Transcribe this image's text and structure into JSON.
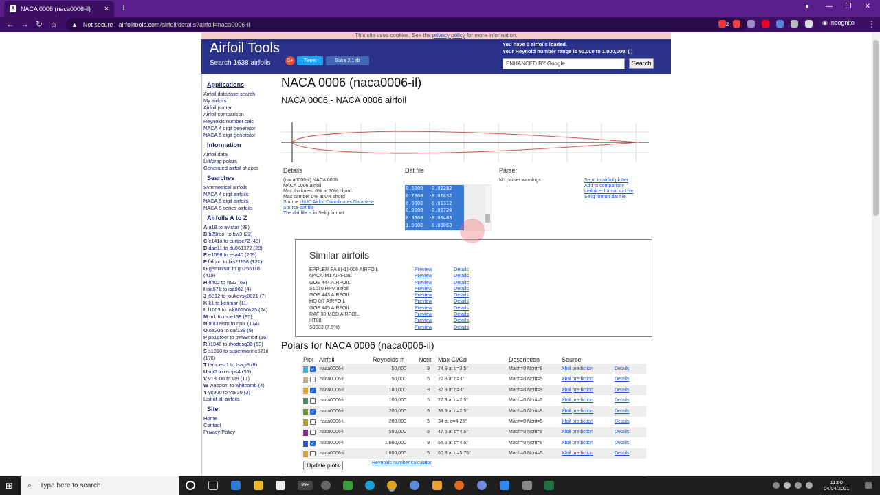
{
  "browser": {
    "tab_title": "NACA 0006 (naca0006-il)",
    "tab_icon": "A",
    "new_tab": "+",
    "close_tab": "×",
    "security": "Not secure",
    "url_host": "airfoiltools.com",
    "url_path": "/airfoil/details?airfoil=naca0006-il",
    "profile": "Incognito"
  },
  "cookie": {
    "prefix": "This site uses cookies. See the ",
    "link": "privacy policy",
    "suffix": " for more information."
  },
  "header": {
    "title": "Airfoil Tools",
    "subtitle": "Search 1638 airfoils",
    "tweet": "Tweet",
    "like": "Suka 2,1 rb",
    "loaded": "You have 0 airfoils loaded.",
    "reynolds": "Your Reynold number range is 50,000 to 1,000,000. ( )",
    "search_placeholder": "ENHANCED BY Google",
    "search_button": "Search"
  },
  "sidebar": {
    "applications_heading": "Applications",
    "applications": [
      "Airfoil database search",
      "My airfoils",
      "Airfoil plotter",
      "Airfoil comparison",
      "Reynolds number calc",
      "NACA 4 digit generator",
      "NACA 5 digit generator"
    ],
    "information_heading": "Information",
    "information": [
      "Airfoil data",
      "Lift/drag polars",
      "Generated airfoil shapes"
    ],
    "searches_heading": "Searches",
    "searches": [
      "Symmetrical airfoils",
      "NACA 4 digit airfoils",
      "NACA 5 digit airfoils",
      "NACA 6 series airfoils"
    ],
    "atoz_heading": "Airfoils A to Z",
    "atoz": [
      {
        "l": "A",
        "t": " a18 to avistar (88)"
      },
      {
        "l": "B",
        "t": " b29root to bw3 (22)"
      },
      {
        "l": "C",
        "t": " c141a to curtisc72 (40)"
      },
      {
        "l": "D",
        "t": " dae11 to du861372 (28)"
      },
      {
        "l": "E",
        "t": " e1098 to esa40 (209)"
      },
      {
        "l": "F",
        "t": " falcon to fxs21158 (121)"
      },
      {
        "l": "G",
        "t": " geminism to gu255118"
      },
      {
        "l": "",
        "t": "(419)"
      },
      {
        "l": "H",
        "t": " hh02 to ht23 (63)"
      },
      {
        "l": "I",
        "t": " isa571 to isa962 (4)"
      },
      {
        "l": "J",
        "t": " j5012 to joukovsk0021 (7)"
      },
      {
        "l": "K",
        "t": " k1 to kenmar (11)"
      },
      {
        "l": "L",
        "t": " l1003 to lwk80150k25 (24)"
      },
      {
        "l": "M",
        "t": " m1 to mue139 (95)"
      },
      {
        "l": "N",
        "t": " n0009sm to nplx (174)"
      },
      {
        "l": "O",
        "t": " oa206 to oaf139 (9)"
      },
      {
        "l": "P",
        "t": " p51droot to pw98mod (16)"
      },
      {
        "l": "R",
        "t": " r1046 to rhodesg36 (63)"
      },
      {
        "l": "S",
        "t": " s1010 to supermarine371ii"
      },
      {
        "l": "",
        "t": "(176)"
      },
      {
        "l": "T",
        "t": " tempest1 to tsagi8 (8)"
      },
      {
        "l": "U",
        "t": " ua2 to usnps4 (36)"
      },
      {
        "l": "V",
        "t": " v13006 to vr9 (17)"
      },
      {
        "l": "W",
        "t": " waspsm to whitcomb (4)"
      },
      {
        "l": "Y",
        "t": " ys900 to ys930 (3)"
      },
      {
        "l": "",
        "t": "List of all airfoils"
      }
    ],
    "site_heading": "Site",
    "site": [
      "Home",
      "Contact",
      "Privacy Policy"
    ]
  },
  "main": {
    "title": "NACA 0006 (naca0006-il)",
    "subtitle": "NACA 0006 - NACA 0006 airfoil",
    "details_heading": "Details",
    "details_lines": [
      "(naca0006-il) NACA 0006",
      "NACA 0006 airfoil",
      "Max thickness 6% at 30% chord.",
      "Max camber 0% at 0% chord"
    ],
    "source_prefix": "Source ",
    "source_link": "UIUC Airfoil Coordinates Database",
    "source_dat": "Source dat file",
    "selig_note": "The dat file is in Selig format",
    "dat_heading": "Dat file",
    "dat_lines": [
      "0.6000  -0.02282",
      "0.7000  -0.01832",
      "0.8000  -0.01312",
      "0.9000  -0.00724",
      "0.9500  -0.00403",
      "1.0000  -0.00063"
    ],
    "parser_heading": "Parser",
    "parser_text": "No parser warnings",
    "links": [
      "Send to airfoil plotter",
      "Add to comparison",
      "Lednicer format dat file",
      "Selig format dat file"
    ]
  },
  "similar": {
    "title": "Similar airfoils",
    "preview": "Preview",
    "details": "Details",
    "items": [
      "EPPLER EA 8(-1)-006 AIRFOIL",
      "NACA-M1 AIRFOIL",
      "GOE 444 AIRFOIL",
      "S1010 HPV airfoil",
      "GOE 443 AIRFOIL",
      "HQ 0/7 AIRFOIL",
      "GOE 445 AIRFOIL",
      "RAF 30 MOD AIRFOIL",
      "HT08",
      "S9033 (7.5%)"
    ]
  },
  "polars": {
    "title": "Polars for NACA 0006 (naca0006-il)",
    "headers": [
      "Plot",
      "Airfoil",
      "Reynolds #",
      "Ncrit",
      "Max Cl/Cd",
      "Description",
      "Source"
    ],
    "rows": [
      {
        "color": "#3fb4d8",
        "checked": true,
        "airfoil": "naca0006-il",
        "re": "50,000",
        "ncrit": "9",
        "max": "24.9 at α=3.5°",
        "desc": "Mach=0 Ncrit=9",
        "src": "Xfoil prediction",
        "det": "Details"
      },
      {
        "color": "#c2b388",
        "checked": false,
        "airfoil": "naca0006-il",
        "re": "50,000",
        "ncrit": "5",
        "max": "22.8 at α=3°",
        "desc": "Mach=0 Ncrit=5",
        "src": "Xfoil prediction",
        "det": "Details"
      },
      {
        "color": "#e8a52e",
        "checked": true,
        "airfoil": "naca0006-il",
        "re": "100,000",
        "ncrit": "9",
        "max": "32.9 at α=3°",
        "desc": "Mach=0 Ncrit=9",
        "src": "Xfoil prediction",
        "det": "Details"
      },
      {
        "color": "#4a8f6a",
        "checked": false,
        "airfoil": "naca0006-il",
        "re": "100,000",
        "ncrit": "5",
        "max": "27.3 at α=2.5°",
        "desc": "Mach=0 Ncrit=5",
        "src": "Xfoil prediction",
        "det": "Details"
      },
      {
        "color": "#6e9b3a",
        "checked": true,
        "airfoil": "naca0006-il",
        "re": "200,000",
        "ncrit": "9",
        "max": "38.9 at α=2.5°",
        "desc": "Mach=0 Ncrit=9",
        "src": "Xfoil prediction",
        "det": "Details"
      },
      {
        "color": "#b59b2a",
        "checked": false,
        "airfoil": "naca0006-il",
        "re": "200,000",
        "ncrit": "5",
        "max": "34 at α=4.25°",
        "desc": "Mach=0 Ncrit=5",
        "src": "Xfoil prediction",
        "det": "Details"
      },
      {
        "color": "#8b2f8c",
        "checked": false,
        "airfoil": "naca0006-il",
        "re": "500,000",
        "ncrit": "5",
        "max": "47.6 at α=4.5°",
        "desc": "Mach=0 Ncrit=5",
        "src": "Xfoil prediction",
        "det": "Details"
      },
      {
        "color": "#2a5bd7",
        "checked": true,
        "airfoil": "naca0006-il",
        "re": "1,000,000",
        "ncrit": "9",
        "max": "56.6 at α=4.5°",
        "desc": "Mach=0 Ncrit=9",
        "src": "Xfoil prediction",
        "det": "Details"
      },
      {
        "color": "#d4a530",
        "checked": false,
        "airfoil": "naca0006-il",
        "re": "1,000,000",
        "ncrit": "5",
        "max": "60.3 at α=5.75°",
        "desc": "Mach=0 Ncrit=5",
        "src": "Xfoil prediction",
        "det": "Details"
      }
    ],
    "update_button": "Update plots",
    "calc_link": "Reynolds number calculator"
  },
  "taskbar": {
    "search_placeholder": "Type here to search",
    "time": "11:50",
    "date": "04/04/2021",
    "badge": "99+"
  }
}
